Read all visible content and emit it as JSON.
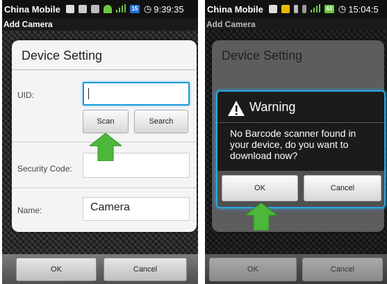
{
  "left": {
    "status": {
      "carrier": "China Mobile",
      "time": "9:39:35",
      "battery": "15"
    },
    "app_title": "Add Camera",
    "dialog": {
      "title": "Device Setting",
      "uid_label": "UID:",
      "uid_value": "",
      "scan_label": "Scan",
      "search_label": "Search",
      "security_label": "Security Code:",
      "security_value": "",
      "name_label": "Name:",
      "name_value": "Camera"
    },
    "bottom": {
      "ok": "OK",
      "cancel": "Cancel"
    }
  },
  "right": {
    "status": {
      "carrier": "China Mobile",
      "time": "15:04:5",
      "battery": "63"
    },
    "app_title": "Add Camera",
    "background_dialog_title": "Device Setting",
    "warning": {
      "title": "Warning",
      "message": "No Barcode scanner found in your device, do you want to download now?",
      "ok": "OK",
      "cancel": "Cancel"
    },
    "bottom": {
      "ok": "OK",
      "cancel": "Cancel"
    }
  },
  "colors": {
    "accent": "#1b9ad6",
    "arrow": "#4bb83a"
  },
  "icons": [
    "warning-icon",
    "arrow-up-icon",
    "signal-icon",
    "battery-icon",
    "clock-icon"
  ]
}
